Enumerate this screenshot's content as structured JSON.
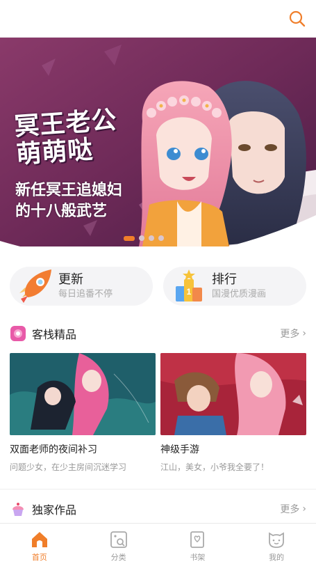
{
  "header": {
    "search_icon": "search-icon"
  },
  "banner": {
    "title": "冥王老公萌萌哒",
    "subtitle_line1": "新任冥王追媳妇",
    "subtitle_line2": "的十八般武艺",
    "slide_count": 4,
    "active_slide": 0
  },
  "quick_links": [
    {
      "title": "更新",
      "subtitle": "每日追番不停",
      "icon": "rocket-icon"
    },
    {
      "title": "排行",
      "subtitle": "国漫优质漫画",
      "icon": "trophy-icon"
    }
  ],
  "sections": [
    {
      "title": "客栈精品",
      "more_label": "更多",
      "icon": "flower-icon",
      "items": [
        {
          "title": "双面老师的夜间补习",
          "subtitle": "问题少女，在少主房间沉迷学习"
        },
        {
          "title": "神级手游",
          "subtitle": "江山，美女，小爷我全要了！"
        }
      ]
    },
    {
      "title": "独家作品",
      "more_label": "更多",
      "icon": "cupcake-icon"
    }
  ],
  "tabbar": {
    "active": "home",
    "items": [
      {
        "id": "home",
        "label": "首页",
        "icon": "home-icon"
      },
      {
        "id": "category",
        "label": "分类",
        "icon": "category-icon"
      },
      {
        "id": "shelf",
        "label": "书架",
        "icon": "bookshelf-icon"
      },
      {
        "id": "mine",
        "label": "我的",
        "icon": "profile-icon"
      }
    ]
  },
  "colors": {
    "accent": "#f07e2a",
    "banner_bg": "#7a2f5e"
  }
}
